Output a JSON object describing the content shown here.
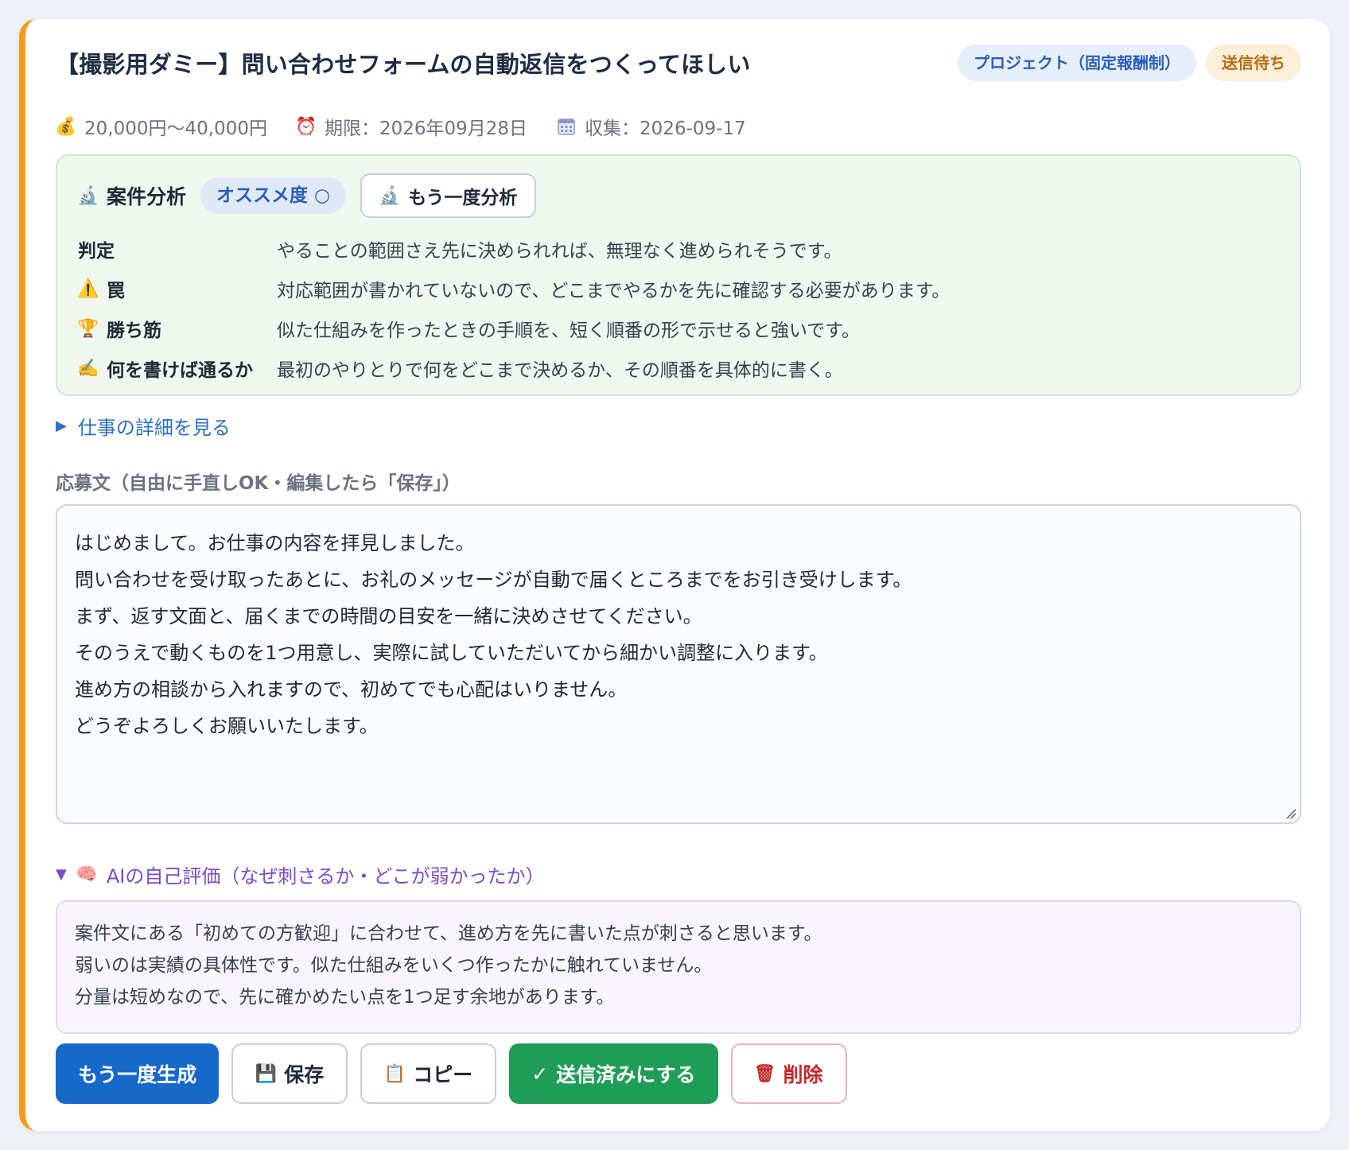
{
  "job": {
    "title": "【撮影用ダミー】問い合わせフォームの自動返信をつくってほしい",
    "badges": {
      "type": "プロジェクト（固定報酬制）",
      "status": "送信待ち"
    },
    "meta": {
      "budget": "20,000円〜40,000円",
      "deadline": "期限：2026年09月28日",
      "collected": "収集：2026-09-17"
    }
  },
  "analysis": {
    "title": "案件分析",
    "recommendation": "オススメ度 ○",
    "reanalyze_label": "もう一度分析",
    "rows": [
      {
        "label": "判定",
        "value": "やることの範囲さえ先に決められれば、無理なく進められそうです。"
      },
      {
        "label": "罠",
        "value": "対応範囲が書かれていないので、どこまでやるかを先に確認する必要があります。"
      },
      {
        "label": "勝ち筋",
        "value": "似た仕組みを作ったときの手順を、短く順番の形で示せると強いです。"
      },
      {
        "label": "何を書けば通るか",
        "value": "最初のやりとりで何をどこまで決めるか、その順番を具体的に書く。"
      }
    ]
  },
  "details_toggle": "仕事の詳細を見る",
  "application": {
    "label": "応募文（自由に手直しOK・編集したら「保存」）",
    "lines": [
      "はじめまして。お仕事の内容を拝見しました。",
      "問い合わせを受け取ったあとに、お礼のメッセージが自動で届くところまでをお引き受けします。",
      "まず、返す文面と、届くまでの時間の目安を一緒に決めさせてください。",
      "そのうえで動くものを1つ用意し、実際に試していただいてから細かい調整に入ります。",
      "進め方の相談から入れますので、初めてでも心配はいりません。",
      "どうぞよろしくお願いいたします。"
    ]
  },
  "ai_review": {
    "toggle": "AIの自己評価（なぜ刺さるか・どこが弱かったか）",
    "lines": [
      "案件文にある「初めての方歓迎」に合わせて、進め方を先に書いた点が刺さると思います。",
      "弱いのは実績の具体性です。似た仕組みをいくつ作ったかに触れていません。",
      "分量は短めなので、先に確かめたい点を1つ足す余地があります。"
    ]
  },
  "actions": {
    "regenerate": "もう一度生成",
    "save": "保存",
    "copy": "コピー",
    "mark_sent": "送信済みにする",
    "delete": "削除"
  },
  "colors": {
    "accent_bar": "#f29d1a",
    "primary": "#1769c9",
    "success": "#1f9d57",
    "danger": "#c62828",
    "analysis_bg": "#eff7ee",
    "ai_bg": "#f8f5fe"
  },
  "icons": {
    "budget": "money-bag-icon",
    "deadline": "alarm-clock-icon",
    "collected": "calendar-icon",
    "analysis": "microscope-icon",
    "trap": "warning-icon",
    "win": "trophy-icon",
    "write": "writing-hand-icon",
    "ai": "brain-icon",
    "save": "floppy-disk-icon",
    "copy": "clipboard-icon",
    "check": "check-icon",
    "delete": "trash-icon"
  }
}
